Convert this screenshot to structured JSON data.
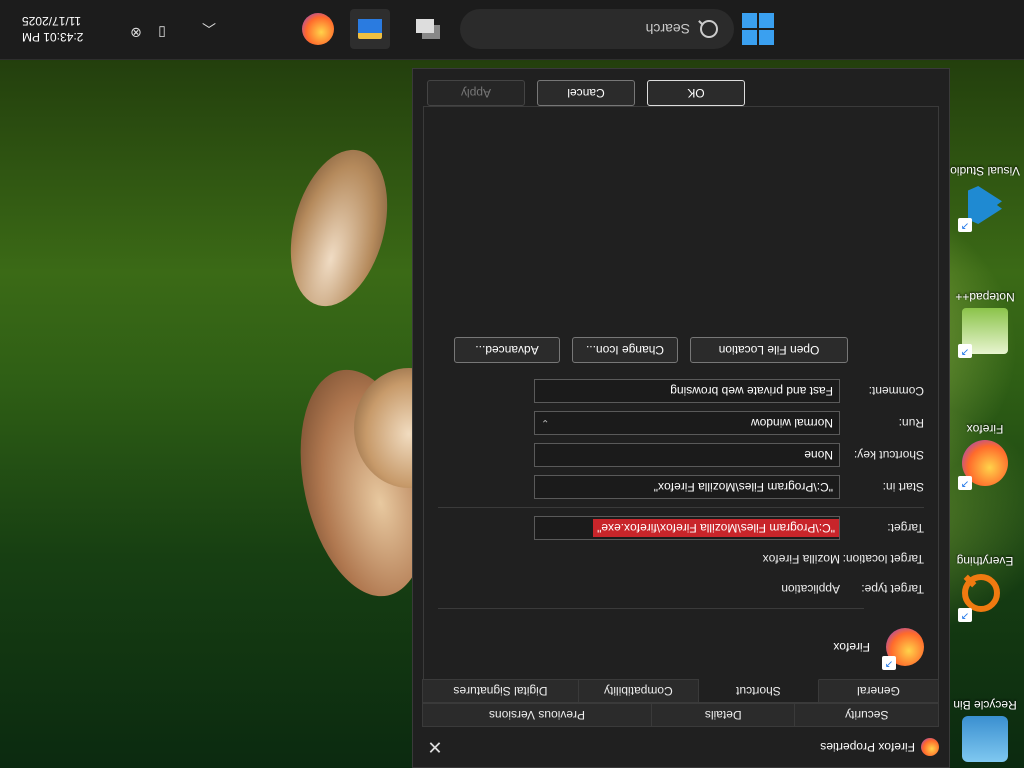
{
  "desktop": {
    "icons": [
      {
        "label": "Recycle Bin",
        "name": "recycle-bin-icon"
      },
      {
        "label": "Everything",
        "name": "everything-icon"
      },
      {
        "label": "Firefox",
        "name": "firefox-desktop-icon"
      },
      {
        "label": "Notepad++",
        "name": "notepad-plus-plus-icon"
      },
      {
        "label": "Visual Studio Code",
        "name": "vscode-icon"
      }
    ]
  },
  "dialog": {
    "title": "Firefox Properties",
    "tabs_top": [
      "Security",
      "Details",
      "Previous Versions"
    ],
    "tabs_bottom": [
      "General",
      "Shortcut",
      "Compatibility",
      "Digital Signatures"
    ],
    "active_tab": "Shortcut",
    "app_name": "Firefox",
    "fields": {
      "target_type_label": "Target type:",
      "target_type_value": "Application",
      "target_location_label": "Target location:",
      "target_location_value": "Mozilla Firefox",
      "target_label": "Target:",
      "target_value": "\"C:\\Program Files\\Mozilla Firefox\\firefox.exe\"",
      "start_in_label": "Start in:",
      "start_in_value": "\"C:\\Program Files\\Mozilla Firefox\"",
      "shortcut_key_label": "Shortcut key:",
      "shortcut_key_value": "None",
      "run_label": "Run:",
      "run_value": "Normal window",
      "comment_label": "Comment:",
      "comment_value": "Fast and private web browsing"
    },
    "buttons": {
      "open_file_location": "Open File Location",
      "change_icon": "Change Icon...",
      "advanced": "Advanced...",
      "ok": "OK",
      "cancel": "Cancel",
      "apply": "Apply"
    }
  },
  "taskbar": {
    "search_placeholder": "Search",
    "time": "2:43:01 PM",
    "date": "11/17/2025"
  }
}
